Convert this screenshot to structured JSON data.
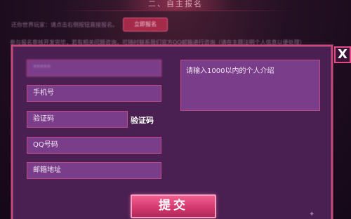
{
  "background_page": {
    "section_title": "二、自主报名",
    "note": "还你世界玩家：请点击右侧按钮直接报名。",
    "register_button": "立即报名",
    "notice_line": "参与报名审核开发完毕，若有相关问题咨询，可随时联系我们官方QQ邮箱进行咨询（请在主题注明个人信息以便处理）"
  },
  "form": {
    "close_label": "X",
    "name_value": "*****",
    "phone_placeholder": "手机号",
    "code_placeholder": "验证码",
    "get_code_label": "验证码",
    "qq_placeholder": "QQ号码",
    "email_placeholder": "邮箱地址",
    "intro_placeholder": "请输入1000以内的个人介绍",
    "submit_label": "提交"
  },
  "colors": {
    "modal_bg": "#4a1f52",
    "accent_pink": "#d0457a",
    "field_bg": "#7a3d8a"
  }
}
